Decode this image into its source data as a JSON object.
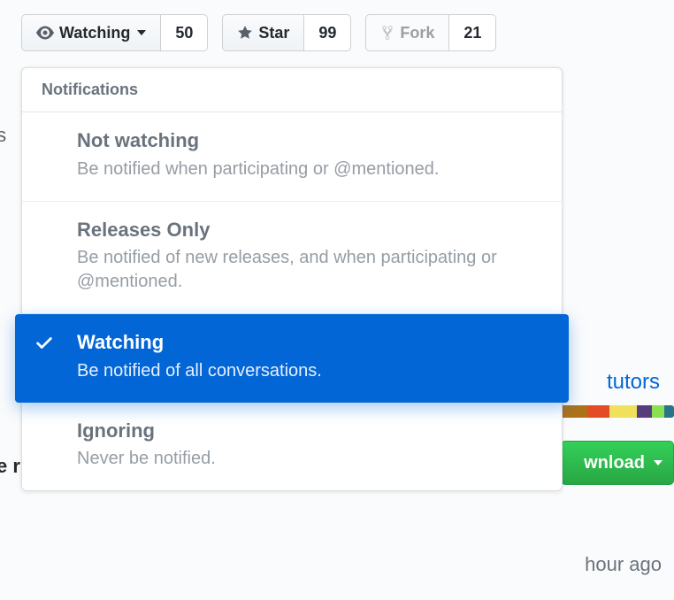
{
  "toolbar": {
    "watch": {
      "label": "Watching",
      "count": "50"
    },
    "star": {
      "label": "Star",
      "count": "99"
    },
    "fork": {
      "label": "Fork",
      "count": "21"
    }
  },
  "dropdown": {
    "header": "Notifications",
    "items": [
      {
        "title": "Not watching",
        "desc": "Be notified when participating or @mentioned."
      },
      {
        "title": "Releases Only",
        "desc": "Be notified of new releases, and when participating or @mentioned."
      },
      {
        "title": "Watching",
        "desc": "Be notified of all conversations."
      },
      {
        "title": "Ignoring",
        "desc": "Never be notified."
      }
    ]
  },
  "bg": {
    "frag_ts": "ts",
    "tutors": "tutors",
    "frag_e": "e r",
    "download": "wnload",
    "hour_ago": "hour ago"
  },
  "lang_colors": [
    "#b07219",
    "#e34c26",
    "#f1e05a",
    "#563d7c",
    "#89e051",
    "#2b7489"
  ]
}
